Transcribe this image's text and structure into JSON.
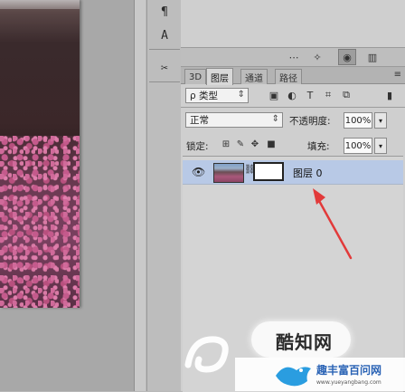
{
  "toolbar_top": {
    "icons": [
      "paragraph-icon",
      "character-icon",
      "tools-icon"
    ]
  },
  "panel_toolbar": {
    "icons": [
      "dotted-circle-icon",
      "compass-icon",
      "eye-icon",
      "trash-icon"
    ]
  },
  "tabs": [
    {
      "label": "3D"
    },
    {
      "label": "图层"
    },
    {
      "label": "通道"
    },
    {
      "label": "路径"
    }
  ],
  "panel_menu_label": "≡",
  "filter": {
    "type_label": "ρ 类型",
    "icons": [
      "image-filter-icon",
      "adjustment-filter-icon",
      "type-filter-icon",
      "shape-filter-icon",
      "smartobject-filter-icon",
      "filter-toggle-icon"
    ]
  },
  "blend": {
    "mode_value": "正常",
    "opacity_label": "不透明度:",
    "opacity_value": "100%"
  },
  "lock": {
    "label": "锁定:",
    "icons": [
      "lock-transparent-icon",
      "lock-pixels-icon",
      "lock-position-icon",
      "lock-all-icon"
    ],
    "fill_label": "填充:",
    "fill_value": "100%"
  },
  "layers": [
    {
      "name": "图层 0",
      "visible": true,
      "selected": true
    }
  ],
  "watermark": {
    "logo_text": "酷知网",
    "site_name": "趣丰富百问网",
    "site_url": "www.yueyangbang.com"
  },
  "colors": {
    "selection": "#b8c9e6",
    "annotation_arrow": "#e23a3a",
    "site_blue": "#2a63b5"
  }
}
